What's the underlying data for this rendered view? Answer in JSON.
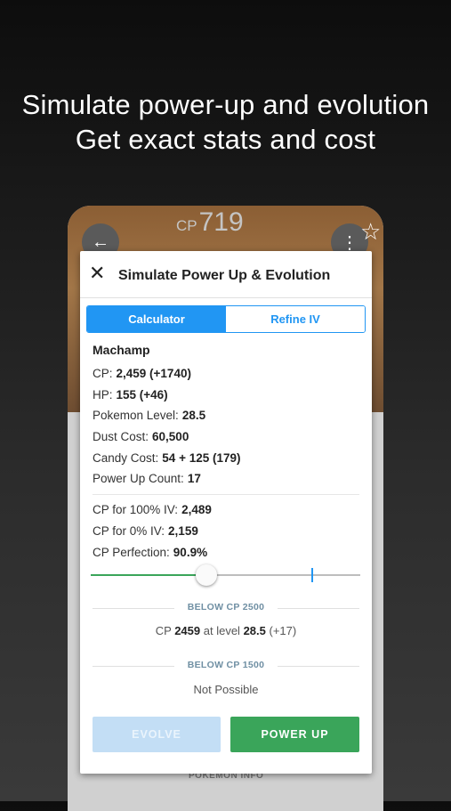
{
  "headline": {
    "line1": "Simulate power-up and evolution",
    "line2": "Get exact stats and cost"
  },
  "phone": {
    "cp_prefix": "CP",
    "cp_value": "719",
    "footer_label": "POKEMON INFO"
  },
  "dialog": {
    "title": "Simulate Power Up & Evolution",
    "tabs": [
      {
        "label": "Calculator",
        "active": true
      },
      {
        "label": "Refine IV",
        "active": false
      }
    ],
    "pokemon_name": "Machamp",
    "stats": [
      {
        "label": "CP:",
        "value": "2,459 (+1740)"
      },
      {
        "label": "HP:",
        "value": "155 (+46)"
      },
      {
        "label": "Pokemon Level:",
        "value": "28.5"
      },
      {
        "label": "Dust Cost:",
        "value": "60,500"
      },
      {
        "label": "Candy Cost:",
        "value": "54 + 125 (179)"
      },
      {
        "label": "Power Up Count:",
        "value": "17"
      }
    ],
    "iv_stats": [
      {
        "label": "CP for 100% IV:",
        "value": "2,489"
      },
      {
        "label": "CP for 0% IV:",
        "value": "2,159"
      },
      {
        "label": "CP Perfection:",
        "value": "90.9%"
      }
    ],
    "slider": {
      "fraction": 0.43,
      "marker_fraction": 0.82
    },
    "below_2500": {
      "heading": "BELOW CP 2500",
      "cp_prefix": "CP",
      "cp_value": "2459",
      "at_level": "at level",
      "level_value": "28.5",
      "delta": "(+17)"
    },
    "below_1500": {
      "heading": "BELOW CP 1500",
      "text": "Not Possible"
    },
    "buttons": {
      "evolve": "EVOLVE",
      "power_up": "POWER UP"
    }
  },
  "colors": {
    "accent_blue": "#2196f3",
    "accent_green": "#3aa55a",
    "disabled_blue": "#c3def5"
  }
}
